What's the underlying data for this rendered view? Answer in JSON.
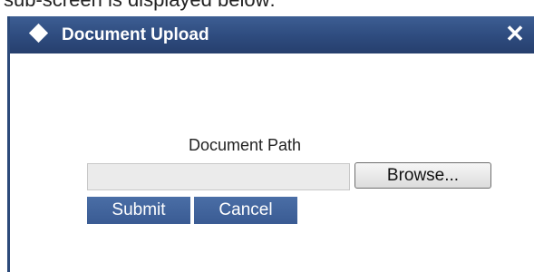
{
  "caption": {
    "text": "sub-screen is displayed below:"
  },
  "dialog": {
    "title": "Document Upload",
    "close_icon": "close-icon",
    "title_icon": "diamond-icon"
  },
  "form": {
    "path_label": "Document Path",
    "path_value": "",
    "browse_label": "Browse...",
    "submit_label": "Submit",
    "cancel_label": "Cancel"
  },
  "colors": {
    "titlebar": "#2e4b7e",
    "action_button": "#3f629c",
    "input_background": "#ebebeb"
  }
}
